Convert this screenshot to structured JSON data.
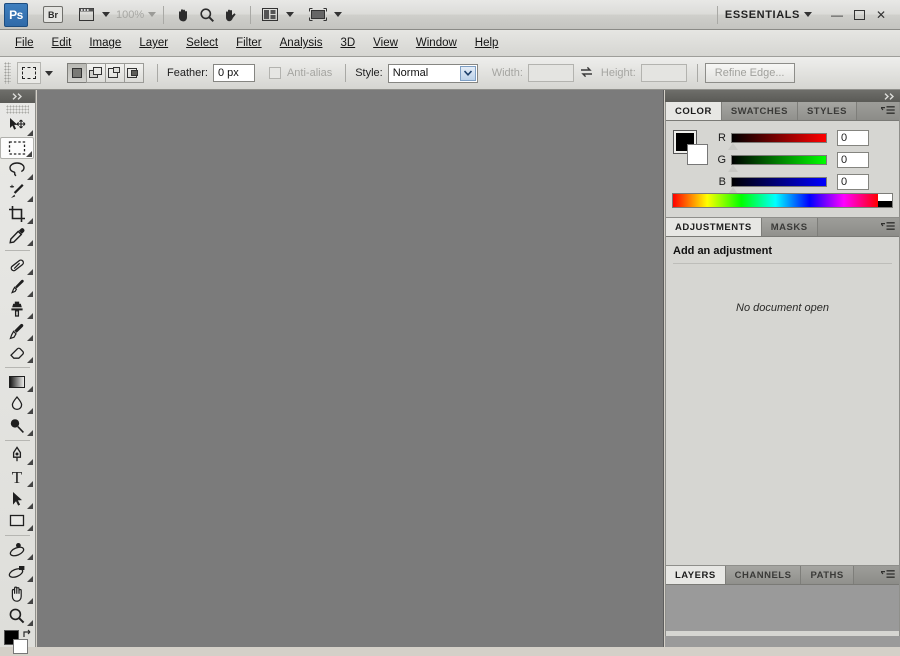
{
  "app": {
    "logo_text": "Ps",
    "bridge_label": "Br",
    "zoom_level": "100%",
    "workspace": "ESSENTIALS",
    "window_buttons": {
      "minimize": "—",
      "maximize": "☐",
      "close": "✕"
    }
  },
  "menu": {
    "items": [
      {
        "label": "File"
      },
      {
        "label": "Edit"
      },
      {
        "label": "Image"
      },
      {
        "label": "Layer"
      },
      {
        "label": "Select"
      },
      {
        "label": "Filter"
      },
      {
        "label": "Analysis"
      },
      {
        "label": "3D"
      },
      {
        "label": "View"
      },
      {
        "label": "Window"
      },
      {
        "label": "Help"
      }
    ]
  },
  "options_bar": {
    "feather_label": "Feather:",
    "feather_value": "0 px",
    "antialias_label": "Anti-alias",
    "style_label": "Style:",
    "style_value": "Normal",
    "width_label": "Width:",
    "width_value": "",
    "height_label": "Height:",
    "height_value": "",
    "refine_edge_label": "Refine Edge..."
  },
  "toolbar": {
    "tools": [
      {
        "name": "move-tool",
        "glyph": "↖",
        "active": false
      },
      {
        "name": "rectangular-marquee-tool",
        "glyph": "⬚",
        "active": true
      },
      {
        "name": "lasso-tool",
        "glyph": "⊃",
        "active": false
      },
      {
        "name": "quick-selection-tool",
        "glyph": "✐",
        "active": false
      },
      {
        "name": "crop-tool",
        "glyph": "⌗",
        "active": false
      },
      {
        "name": "eyedropper-tool",
        "glyph": "✒",
        "active": false
      },
      {
        "name": "spot-healing-brush-tool",
        "glyph": "⍁",
        "active": false
      },
      {
        "name": "brush-tool",
        "glyph": "✐",
        "active": false
      },
      {
        "name": "clone-stamp-tool",
        "glyph": "⚓",
        "active": false
      },
      {
        "name": "history-brush-tool",
        "glyph": "✎",
        "active": false
      },
      {
        "name": "eraser-tool",
        "glyph": "▱",
        "active": false
      },
      {
        "name": "gradient-tool",
        "glyph": "▤",
        "active": false
      },
      {
        "name": "blur-tool",
        "glyph": "●",
        "active": false
      },
      {
        "name": "dodge-tool",
        "glyph": "⚲",
        "active": false
      },
      {
        "name": "pen-tool",
        "glyph": "✑",
        "active": false
      },
      {
        "name": "horizontal-type-tool",
        "glyph": "T",
        "active": false
      },
      {
        "name": "path-selection-tool",
        "glyph": "➤",
        "active": false
      },
      {
        "name": "rectangle-tool",
        "glyph": "▭",
        "active": false
      },
      {
        "name": "3d-object-rotate-tool",
        "glyph": "↺",
        "active": false
      },
      {
        "name": "3d-camera-rotate-tool",
        "glyph": "↻",
        "active": false
      },
      {
        "name": "hand-tool",
        "glyph": "✋",
        "active": false
      },
      {
        "name": "zoom-tool",
        "glyph": "⚲",
        "active": false
      }
    ],
    "foreground_color": "#000000",
    "background_color": "#ffffff"
  },
  "color_panel": {
    "tabs": [
      {
        "label": "COLOR",
        "active": true
      },
      {
        "label": "SWATCHES",
        "active": false
      },
      {
        "label": "STYLES",
        "active": false
      }
    ],
    "channels": [
      {
        "label": "R",
        "value": "0"
      },
      {
        "label": "G",
        "value": "0"
      },
      {
        "label": "B",
        "value": "0"
      }
    ]
  },
  "adjustments_panel": {
    "tabs": [
      {
        "label": "ADJUSTMENTS",
        "active": true
      },
      {
        "label": "MASKS",
        "active": false
      }
    ],
    "title": "Add an adjustment",
    "empty_message": "No document open"
  },
  "layers_panel": {
    "tabs": [
      {
        "label": "LAYERS",
        "active": true
      },
      {
        "label": "CHANNELS",
        "active": false
      },
      {
        "label": "PATHS",
        "active": false
      }
    ]
  },
  "colors": {
    "canvas_background": "#7b7b7b",
    "panel_background": "#d6d6d2",
    "chrome": "#d4d0c8",
    "accent": "#3f7fbf"
  }
}
